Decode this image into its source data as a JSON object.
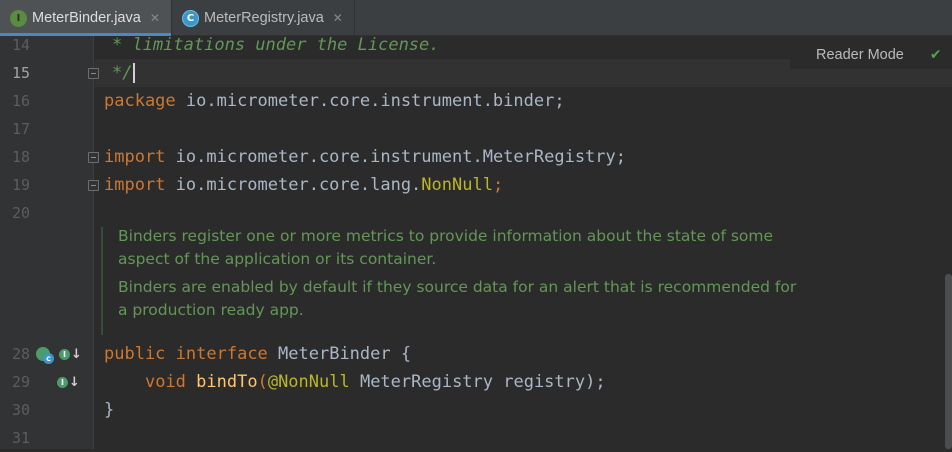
{
  "tabs": [
    {
      "label": "MeterBinder.java",
      "icon": "I",
      "active": true
    },
    {
      "label": "MeterRegistry.java",
      "icon": "C",
      "active": false
    }
  ],
  "tab_close_glyph": "✕",
  "reader_mode": {
    "label": "Reader Mode",
    "check": "✔"
  },
  "gutter": {
    "line_numbers": [
      "14",
      "15",
      "16",
      "17",
      "18",
      "19",
      "20",
      "28",
      "29",
      "30",
      "31"
    ],
    "current_line": "15"
  },
  "code": {
    "l14": "* limitations under the License.",
    "l15": "*/",
    "l16_kw": "package",
    "l16_rest": " io.micrometer.core.instrument.binder;",
    "l18_kw": "import",
    "l18_rest": " io.micrometer.core.instrument.MeterRegistry;",
    "l19_kw": "import",
    "l19_rest": " io.micrometer.core.lang.",
    "l19_ann": "NonNull",
    "l19_semi": ";",
    "l28_kw1": "public",
    "l28_kw2": "interface",
    "l28_rest": " MeterBinder {",
    "l29_kw": "void",
    "l29_fn": "bindTo",
    "l29_open": "(",
    "l29_ann": "@NonNull",
    "l29_rest": " MeterRegistry registry);",
    "l30": "}"
  },
  "javadoc": {
    "p1": "Binders register one or more metrics to provide information about the state of some aspect of the application or its container.",
    "p2": "Binders are enabled by default if they source data for an alert that is recommended for a production ready app."
  },
  "colors": {
    "background": "#2b2b2b",
    "keyword": "#cc7832",
    "comment": "#629755",
    "annotation": "#bbb529",
    "function": "#ffc66d",
    "text": "#a9b7c6"
  }
}
